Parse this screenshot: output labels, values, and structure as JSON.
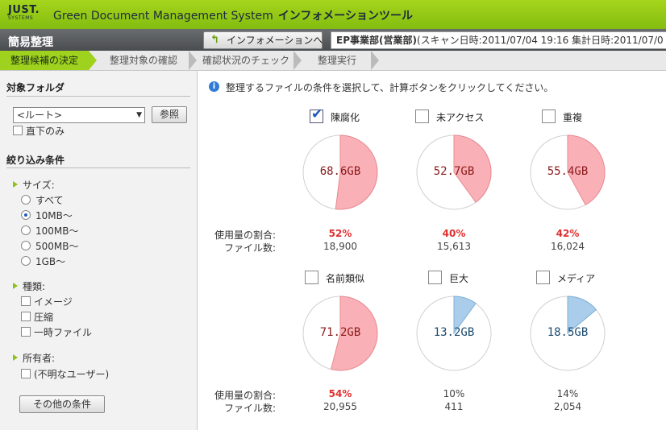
{
  "header": {
    "logo_line1": "JUST.",
    "logo_line2": "SYSTEMS",
    "app_title": "Green Document Management System",
    "app_subtitle": "インフォメーションツール"
  },
  "toolbar": {
    "page_title": "簡易整理",
    "info_button_label": "インフォメーションへ",
    "department": "EP事業部(営業部)",
    "scan_info": "(スキャン日時:2011/07/04 19:16 集計日時:2011/07/0"
  },
  "steps": [
    {
      "label": "整理候補の決定",
      "active": true
    },
    {
      "label": "整理対象の確認",
      "active": false
    },
    {
      "label": "確認状況のチェック",
      "active": false
    },
    {
      "label": "整理実行",
      "active": false
    }
  ],
  "sidebar": {
    "folder_title": "対象フォルダ",
    "folder_value": "<ルート>",
    "browse_label": "参照",
    "direct_only_label": "直下のみ",
    "filter_title": "絞り込み条件",
    "size_title": "サイズ:",
    "size_options": [
      "すべて",
      "10MB〜",
      "100MB〜",
      "500MB〜",
      "1GB〜"
    ],
    "size_selected": "10MB〜",
    "type_title": "種類:",
    "type_options": [
      "イメージ",
      "圧縮",
      "一時ファイル"
    ],
    "owner_title": "所有者:",
    "owner_options": [
      "(不明なユーザー)"
    ],
    "other_button_label": "その他の条件"
  },
  "main": {
    "instruction": "整理するファイルの条件を選択して、計算ボタンをクリックしてください。",
    "usage_label": "使用量の割合:",
    "count_label": "ファイル数:",
    "cards": [
      {
        "label": "陳腐化",
        "checked": true,
        "size": "68.6GB",
        "percent": "52%",
        "fraction": 0.52,
        "count": "18,900",
        "highlight": true
      },
      {
        "label": "未アクセス",
        "checked": false,
        "size": "52.7GB",
        "percent": "40%",
        "fraction": 0.4,
        "count": "15,613",
        "highlight": true
      },
      {
        "label": "重複",
        "checked": false,
        "size": "55.4GB",
        "percent": "42%",
        "fraction": 0.42,
        "count": "16,024",
        "highlight": true
      },
      {
        "label": "名前類似",
        "checked": false,
        "size": "71.2GB",
        "percent": "54%",
        "fraction": 0.54,
        "count": "20,955",
        "highlight": true
      },
      {
        "label": "巨大",
        "checked": false,
        "size": "13.2GB",
        "percent": "10%",
        "fraction": 0.1,
        "count": "411",
        "highlight": false
      },
      {
        "label": "メディア",
        "checked": false,
        "size": "18.5GB",
        "percent": "14%",
        "fraction": 0.14,
        "count": "2,054",
        "highlight": false
      }
    ]
  },
  "colors": {
    "accent_green": "#9fd21e",
    "pie_red_fill": "#f9b0b6",
    "pie_red_stroke": "#e88a92",
    "pie_red_text": "#8a1a1a",
    "pie_blue_fill": "#a9cdea",
    "pie_blue_stroke": "#7fb0d8",
    "pie_blue_text": "#1a4a6e",
    "pct_red": "#e03030"
  }
}
